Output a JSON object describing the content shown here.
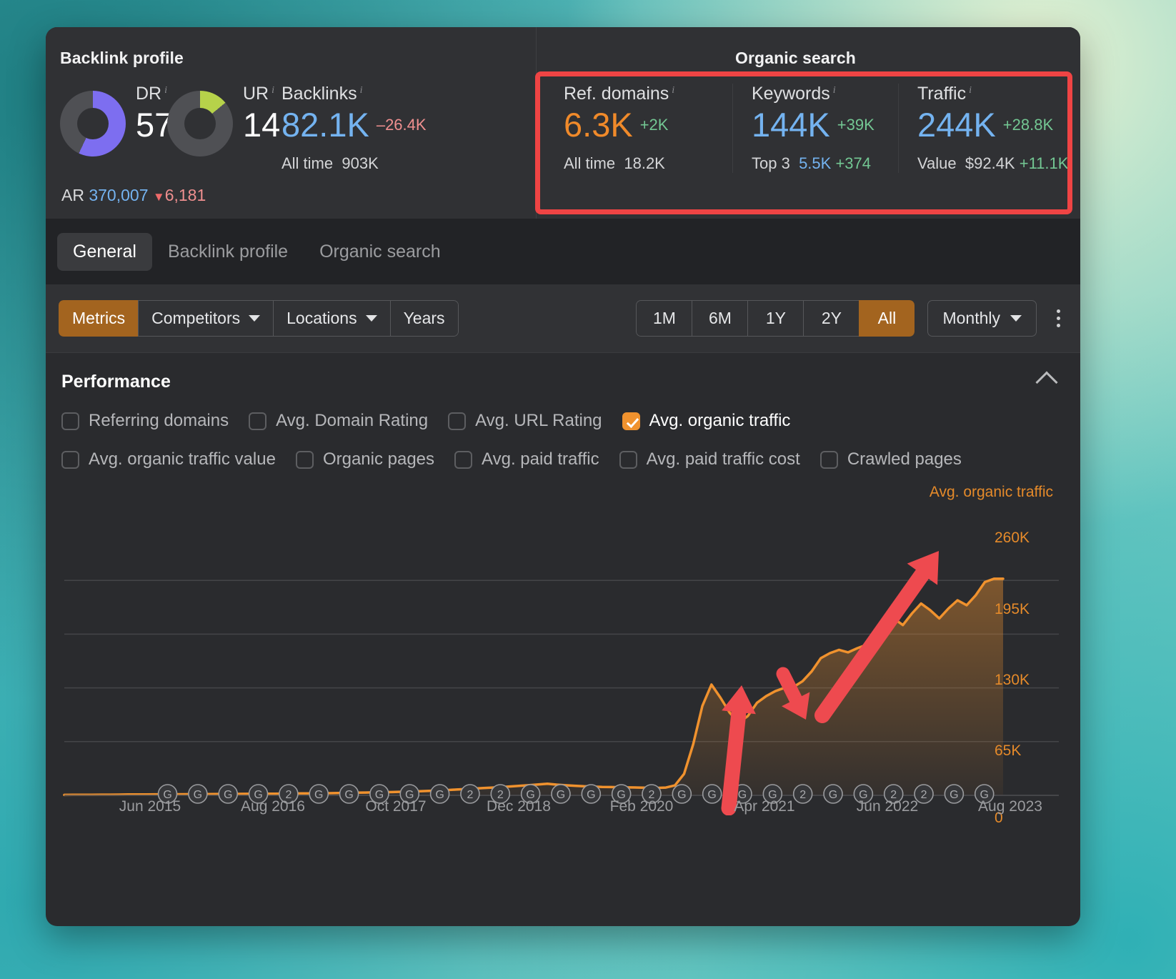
{
  "backlink_panel": {
    "title": "Backlink profile",
    "dr": {
      "label": "DR",
      "value": "57",
      "donut_pct": 57,
      "color": "#7d6ef0"
    },
    "ur": {
      "label": "UR",
      "value": "14",
      "donut_pct": 14,
      "color": "#b6d24a"
    },
    "backlinks": {
      "label": "Backlinks",
      "value": "82.1K",
      "delta": "–26.4K",
      "sub_label": "All time",
      "sub_value": "903K"
    },
    "ar": {
      "label": "AR",
      "value": "370,007",
      "delta": "6,181",
      "trend": "down"
    }
  },
  "organic_panel": {
    "title": "Organic search",
    "highlighted": true,
    "highlight_color": "#ef4444",
    "metrics": [
      {
        "label": "Ref. domains",
        "value": "6.3K",
        "value_color": "#f08a2a",
        "delta": "+2K",
        "sub_label": "All time",
        "sub_value": "18.2K",
        "sub_delta": ""
      },
      {
        "label": "Keywords",
        "value": "144K",
        "value_color": "#74b3f0",
        "delta": "+39K",
        "sub_label": "Top 3",
        "sub_value": "5.5K",
        "sub_delta": "+374"
      },
      {
        "label": "Traffic",
        "value": "244K",
        "value_color": "#74b3f0",
        "delta": "+28.8K",
        "sub_label": "Value",
        "sub_value": "$92.4K",
        "sub_delta": "+11.1K"
      }
    ]
  },
  "tabs": [
    {
      "label": "General",
      "active": true
    },
    {
      "label": "Backlink profile",
      "active": false
    },
    {
      "label": "Organic search",
      "active": false
    }
  ],
  "toolbar": {
    "left_segments": [
      {
        "label": "Metrics",
        "active": true,
        "caret": false
      },
      {
        "label": "Competitors",
        "active": false,
        "caret": true
      },
      {
        "label": "Locations",
        "active": false,
        "caret": true
      },
      {
        "label": "Years",
        "active": false,
        "caret": false
      }
    ],
    "ranges": [
      {
        "label": "1M",
        "active": false
      },
      {
        "label": "6M",
        "active": false
      },
      {
        "label": "1Y",
        "active": false
      },
      {
        "label": "2Y",
        "active": false
      },
      {
        "label": "All",
        "active": true
      }
    ],
    "granularity": "Monthly",
    "more_menu": "kebab-menu-icon"
  },
  "performance": {
    "title": "Performance",
    "collapse_icon": "chevron-up-icon",
    "checkboxes_row1": [
      {
        "label": "Referring domains",
        "checked": false
      },
      {
        "label": "Avg. Domain Rating",
        "checked": false
      },
      {
        "label": "Avg. URL Rating",
        "checked": false
      },
      {
        "label": "Avg. organic traffic",
        "checked": true
      }
    ],
    "checkboxes_row2": [
      {
        "label": "Avg. organic traffic value",
        "checked": false
      },
      {
        "label": "Organic pages",
        "checked": false
      },
      {
        "label": "Avg. paid traffic",
        "checked": false
      },
      {
        "label": "Avg. paid traffic cost",
        "checked": false
      },
      {
        "label": "Crawled pages",
        "checked": false
      }
    ]
  },
  "chart_data": {
    "type": "area",
    "title": "",
    "legend": "Avg. organic traffic",
    "legend_position": "top-right",
    "series_name": "Avg. organic traffic",
    "line_color": "#f0922e",
    "fill_color": "rgba(240,146,46,0.28)",
    "grid": true,
    "xlabel": "",
    "ylabel": "",
    "ylim": [
      0,
      325
    ],
    "y_ticks": [
      "260K",
      "195K",
      "130K",
      "65K",
      "0"
    ],
    "y_tick_values": [
      260,
      195,
      130,
      65,
      0
    ],
    "x_ticks": [
      "Jun 2015",
      "Aug 2016",
      "Oct 2017",
      "Dec 2018",
      "Feb 2020",
      "Apr 2021",
      "Jun 2022",
      "Aug 2023"
    ],
    "x_unit": "month",
    "values_k": [
      0.5,
      0.6,
      0.6,
      0.7,
      0.8,
      0.8,
      0.9,
      1.0,
      1.0,
      1.1,
      1.2,
      1.2,
      1.3,
      1.3,
      1.4,
      1.5,
      1.5,
      1.6,
      1.7,
      1.7,
      1.8,
      1.9,
      2.0,
      2.0,
      2.1,
      2.2,
      2.3,
      2.4,
      2.5,
      2.6,
      2.8,
      3.0,
      3.2,
      3.4,
      3.6,
      3.8,
      4.0,
      4.3,
      4.6,
      5.0,
      5.4,
      5.8,
      6.4,
      7.0,
      7.6,
      8.2,
      8.8,
      9.4,
      10.0,
      10.8,
      11.6,
      12.4,
      13.2,
      14.0,
      13.0,
      12.2,
      11.6,
      11.0,
      10.6,
      10.2,
      10.0,
      9.8,
      9.6,
      9.4,
      9.2,
      9.0,
      9.4,
      12.0,
      26.0,
      62.0,
      108.0,
      134.0,
      118.0,
      100.0,
      88.0,
      96.0,
      112.0,
      120.0,
      126.0,
      130.0,
      131.0,
      138.0,
      150.0,
      166.0,
      172.0,
      176.0,
      173.0,
      178.0,
      182.0,
      186.0,
      198.0,
      214.0,
      206.0,
      220.0,
      232.0,
      224.0,
      214.0,
      226.0,
      236.0,
      230.0,
      242.0,
      258.0,
      262.0,
      262.0
    ],
    "annotations": [
      {
        "type": "arrow",
        "color": "#ef4444",
        "meaning": "traffic-takeoff-up"
      },
      {
        "type": "arrow",
        "color": "#ef4444",
        "meaning": "dip-down"
      },
      {
        "type": "arrow",
        "color": "#ef4444",
        "meaning": "sustained-growth-up"
      }
    ],
    "marker_icons": [
      "G",
      "G",
      "G",
      "G",
      "2",
      "G",
      "G",
      "G",
      "G",
      "G",
      "2",
      "2",
      "G",
      "G",
      "G",
      "G",
      "2",
      "G",
      "G",
      "G",
      "G",
      "2",
      "G",
      "G",
      "2",
      "2",
      "G",
      "G"
    ]
  }
}
